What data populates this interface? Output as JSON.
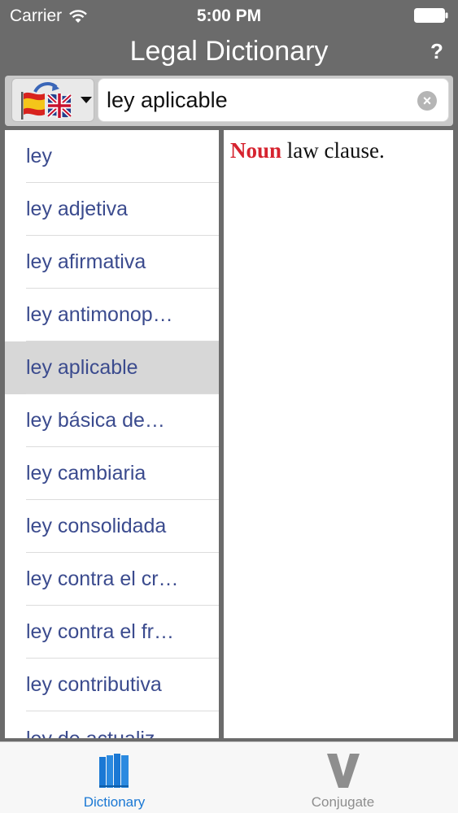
{
  "status_bar": {
    "carrier": "Carrier",
    "time": "5:00 PM"
  },
  "nav": {
    "title": "Legal Dictionary",
    "help_label": "?"
  },
  "search": {
    "value": "ley aplicable",
    "lang_picker_icon": "spain-uk-flags-icon"
  },
  "word_list": {
    "items": [
      "ley",
      "ley adjetiva",
      "ley afirmativa",
      "ley antimonop…",
      "ley aplicable",
      "ley básica de…",
      "ley cambiaria",
      "ley consolidada",
      "ley contra el cr…",
      "ley contra el fr…",
      "ley contributiva",
      "ley de actualiz…"
    ],
    "selected_index": 4
  },
  "definition": {
    "part_of_speech": "Noun",
    "text": " law clause."
  },
  "tab_bar": {
    "tabs": [
      {
        "label": "Dictionary",
        "icon": "books-icon",
        "active": true
      },
      {
        "label": "Conjugate",
        "icon": "v-letter-icon",
        "active": false
      }
    ]
  },
  "colors": {
    "accent": "#1a78d4",
    "word_text": "#3b4b8e",
    "pos_red": "#d6232f",
    "chrome_gray": "#6b6b6b"
  }
}
